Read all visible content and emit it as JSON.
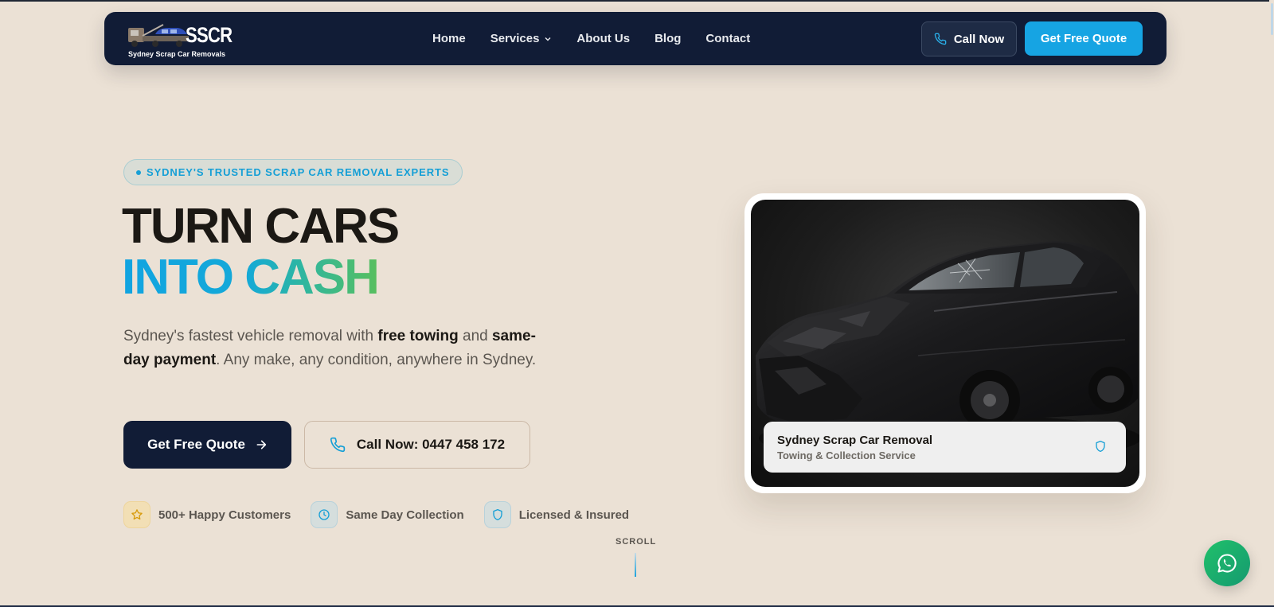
{
  "colors": {
    "background": "#ebe1d5",
    "navy": "#111c36",
    "accent_blue": "#16a4e3",
    "accent_green": "#63c14d",
    "whatsapp_green": "#20c06a"
  },
  "navbar": {
    "logo": {
      "mark": "SSCR",
      "subtitle": "Sydney Scrap Car Removals",
      "icon": "tow-truck-icon"
    },
    "links": [
      {
        "label": "Home"
      },
      {
        "label": "Services",
        "icon": "chevron-down-icon"
      },
      {
        "label": "About Us"
      },
      {
        "label": "Blog"
      },
      {
        "label": "Contact"
      }
    ],
    "call_button": {
      "label": "Call Now",
      "icon": "phone-icon"
    },
    "quote_button": {
      "label": "Get Free Quote"
    }
  },
  "hero": {
    "badge": "SYDNEY'S TRUSTED SCRAP CAR REMOVAL EXPERTS",
    "headline_line1": "TURN CARS",
    "headline_line2": "INTO CASH",
    "lead": {
      "part1": "Sydney's fastest vehicle removal with ",
      "bold1": "free towing",
      "part2": " and ",
      "bold2": "same-day payment",
      "part3": ". Any make, any condition, anywhere in Sydney."
    },
    "primary_button": {
      "label": "Get Free Quote",
      "icon": "arrow-right-icon"
    },
    "secondary_button": {
      "label": "Call Now: 0447 458 172",
      "icon": "phone-icon"
    },
    "features": [
      {
        "label": "500+ Happy Customers",
        "icon": "star-icon"
      },
      {
        "label": "Same Day Collection",
        "icon": "clock-icon"
      },
      {
        "label": "Licensed & Insured",
        "icon": "shield-icon"
      }
    ],
    "scroll_hint": "SCROLL"
  },
  "car_card": {
    "title": "Sydney Scrap Car Removal",
    "subtitle": "Towing & Collection Service",
    "icon": "shield-icon"
  },
  "whatsapp": {
    "icon": "whatsapp-icon"
  }
}
